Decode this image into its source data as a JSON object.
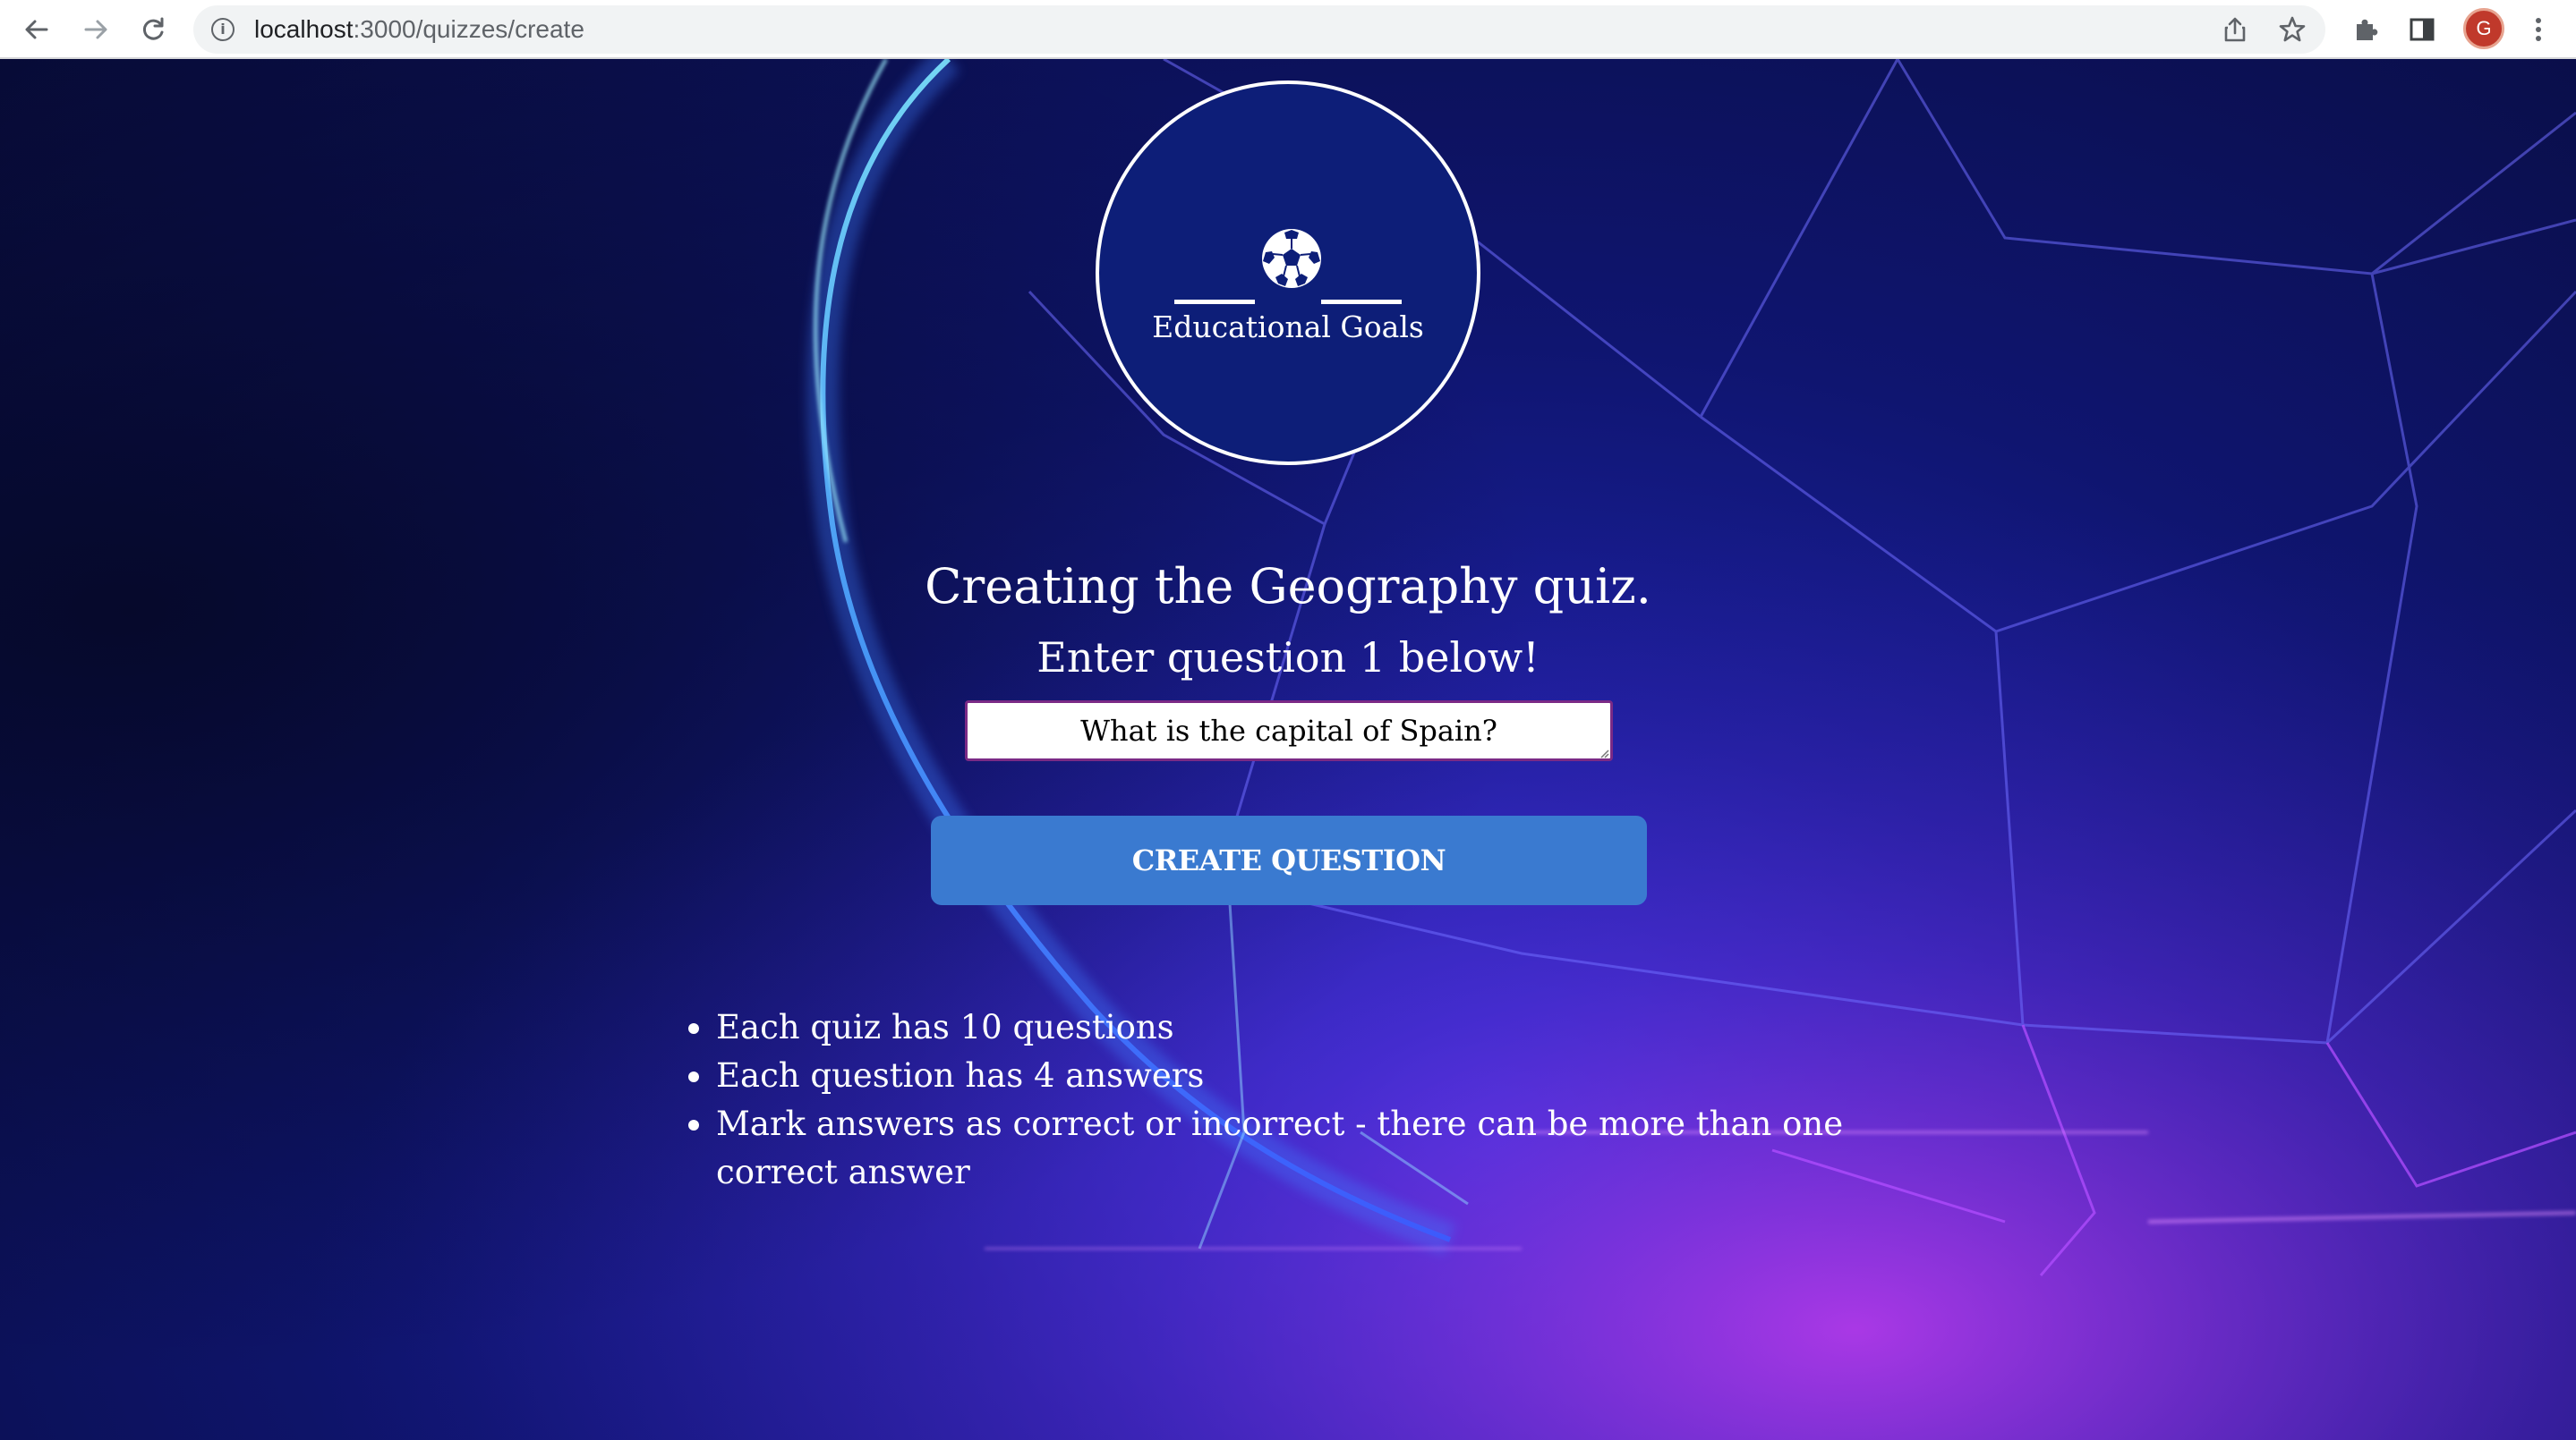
{
  "browser": {
    "url_host": "localhost",
    "url_path": ":3000/quizzes/create",
    "back_icon": "arrow-left-icon",
    "forward_icon": "arrow-right-icon",
    "reload_icon": "reload-icon",
    "profile_initial": "G",
    "profile_color": "#c0392b"
  },
  "logo": {
    "icon": "soccer-ball-icon",
    "name": "Educational Goals"
  },
  "page": {
    "title": "Creating the Geography quiz.",
    "subtitle": "Enter question 1 below!"
  },
  "question_input": {
    "value": "What is the capital of Spain?"
  },
  "create_button": {
    "label": "CREATE QUESTION",
    "color": "#3a7ad0"
  },
  "rules": [
    "Each quiz has 10 questions",
    "Each question has 4 answers",
    "Mark answers as correct or incorrect - there can be more than one correct answer"
  ]
}
